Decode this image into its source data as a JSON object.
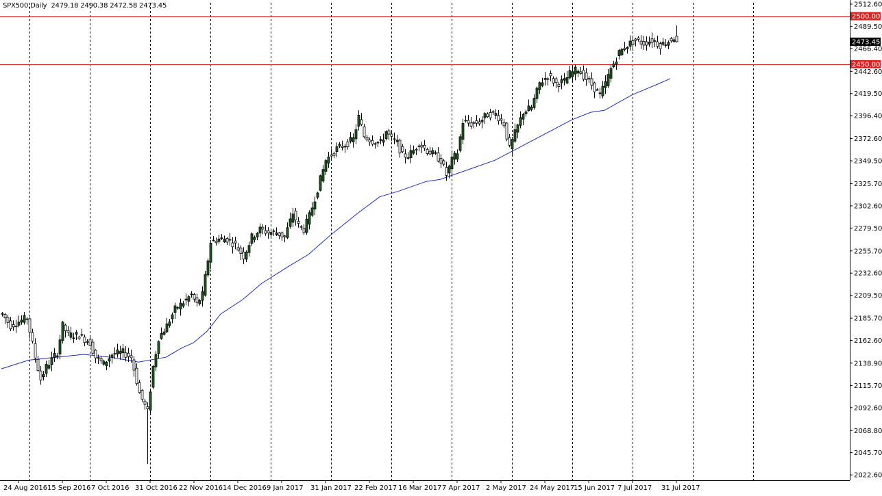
{
  "chart_data": {
    "type": "candlestick",
    "symbol_header": "SPX500,Daily",
    "ohlc_readout": "2479.18 2490.38 2472.58 2473.45",
    "current_price_label": "2473.45",
    "colors": {
      "background": "#ffffff",
      "bull_body": "#1f5f1f",
      "bear_body": "#ffffff",
      "candle_outline": "#000000",
      "moving_average": "#1c2bb8",
      "horizontal_level": "#e02020",
      "level_label_bg": "#e02020",
      "price_label_bg": "#000000",
      "grid": "#000000"
    },
    "y_axis": {
      "ylim": [
        2017,
        2514
      ],
      "ticks": [
        "2512.60",
        "2489.50",
        "2466.40",
        "2442.60",
        "2419.50",
        "2396.40",
        "2372.60",
        "2349.50",
        "2325.70",
        "2302.60",
        "2279.50",
        "2255.70",
        "2232.60",
        "2209.50",
        "2185.70",
        "2162.60",
        "2138.90",
        "2115.70",
        "2092.60",
        "2068.80",
        "2045.70",
        "2022.60"
      ]
    },
    "x_axis": {
      "labels": [
        "24 Aug 2016",
        "15 Sep 2016",
        "7 Oct 2016",
        "31 Oct 2016",
        "22 Nov 2016",
        "14 Dec 2016",
        "9 Jan 2017",
        "31 Jan 2017",
        "22 Feb 2017",
        "16 Mar 2017",
        "7 Apr 2017",
        "2 May 2017",
        "24 May 2017",
        "15 Jun 2017",
        "7 Jul 2017",
        "31 Jul 2017"
      ],
      "total_slots": 270,
      "label_slots": [
        2,
        18,
        34,
        50,
        66,
        82,
        98,
        114,
        130,
        146,
        162,
        178,
        194,
        210,
        226,
        242
      ],
      "grid_slots": [
        6,
        28,
        50,
        72,
        94,
        116,
        138,
        160,
        182,
        204,
        226,
        248,
        270
      ]
    },
    "horizontal_levels": [
      {
        "label": "2500.00",
        "value": 2500.0
      },
      {
        "label": "2450.00",
        "value": 2450.0
      }
    ],
    "anchors": [
      [
        0,
        2190
      ],
      [
        3,
        2178
      ],
      [
        6,
        2182
      ],
      [
        9,
        2186
      ],
      [
        12,
        2145
      ],
      [
        14,
        2122
      ],
      [
        16,
        2135
      ],
      [
        20,
        2150
      ],
      [
        22,
        2178
      ],
      [
        24,
        2168
      ],
      [
        28,
        2168
      ],
      [
        32,
        2160
      ],
      [
        34,
        2145
      ],
      [
        37,
        2138
      ],
      [
        40,
        2148
      ],
      [
        44,
        2150
      ],
      [
        47,
        2145
      ],
      [
        50,
        2108
      ],
      [
        53,
        2088
      ],
      [
        55,
        2135
      ],
      [
        57,
        2165
      ],
      [
        60,
        2178
      ],
      [
        63,
        2195
      ],
      [
        66,
        2202
      ],
      [
        69,
        2210
      ],
      [
        71,
        2200
      ],
      [
        73,
        2210
      ],
      [
        76,
        2265
      ],
      [
        79,
        2268
      ],
      [
        82,
        2268
      ],
      [
        85,
        2262
      ],
      [
        88,
        2250
      ],
      [
        91,
        2270
      ],
      [
        94,
        2278
      ],
      [
        97,
        2275
      ],
      [
        100,
        2275
      ],
      [
        103,
        2270
      ],
      [
        106,
        2295
      ],
      [
        108,
        2282
      ],
      [
        110,
        2278
      ],
      [
        112,
        2292
      ],
      [
        115,
        2320
      ],
      [
        118,
        2350
      ],
      [
        122,
        2362
      ],
      [
        126,
        2368
      ],
      [
        128,
        2372
      ],
      [
        130,
        2395
      ],
      [
        132,
        2375
      ],
      [
        135,
        2370
      ],
      [
        138,
        2368
      ],
      [
        140,
        2380
      ],
      [
        142,
        2372
      ],
      [
        144,
        2368
      ],
      [
        146,
        2355
      ],
      [
        148,
        2355
      ],
      [
        150,
        2360
      ],
      [
        152,
        2368
      ],
      [
        155,
        2360
      ],
      [
        158,
        2355
      ],
      [
        160,
        2350
      ],
      [
        162,
        2335
      ],
      [
        164,
        2350
      ],
      [
        166,
        2358
      ],
      [
        168,
        2390
      ],
      [
        171,
        2388
      ],
      [
        174,
        2390
      ],
      [
        177,
        2398
      ],
      [
        180,
        2398
      ],
      [
        183,
        2388
      ],
      [
        185,
        2362
      ],
      [
        187,
        2378
      ],
      [
        190,
        2400
      ],
      [
        193,
        2405
      ],
      [
        196,
        2430
      ],
      [
        199,
        2438
      ],
      [
        202,
        2430
      ],
      [
        205,
        2432
      ],
      [
        207,
        2440
      ],
      [
        210,
        2445
      ],
      [
        212,
        2438
      ],
      [
        214,
        2432
      ],
      [
        216,
        2425
      ],
      [
        218,
        2418
      ],
      [
        220,
        2430
      ],
      [
        222,
        2445
      ],
      [
        225,
        2462
      ],
      [
        228,
        2470
      ],
      [
        231,
        2475
      ],
      [
        234,
        2472
      ],
      [
        237,
        2475
      ],
      [
        240,
        2470
      ],
      [
        243,
        2474
      ],
      [
        246,
        2480
      ]
    ],
    "moving_average": [
      [
        0,
        2133
      ],
      [
        10,
        2142
      ],
      [
        20,
        2145
      ],
      [
        30,
        2148
      ],
      [
        40,
        2145
      ],
      [
        50,
        2140
      ],
      [
        60,
        2145
      ],
      [
        66,
        2155
      ],
      [
        70,
        2160
      ],
      [
        75,
        2172
      ],
      [
        80,
        2190
      ],
      [
        88,
        2205
      ],
      [
        95,
        2222
      ],
      [
        105,
        2240
      ],
      [
        112,
        2252
      ],
      [
        120,
        2272
      ],
      [
        130,
        2295
      ],
      [
        138,
        2312
      ],
      [
        145,
        2318
      ],
      [
        155,
        2328
      ],
      [
        160,
        2330
      ],
      [
        170,
        2340
      ],
      [
        180,
        2350
      ],
      [
        190,
        2365
      ],
      [
        200,
        2380
      ],
      [
        208,
        2392
      ],
      [
        215,
        2400
      ],
      [
        220,
        2402
      ],
      [
        230,
        2418
      ],
      [
        240,
        2430
      ],
      [
        244,
        2435
      ]
    ]
  }
}
